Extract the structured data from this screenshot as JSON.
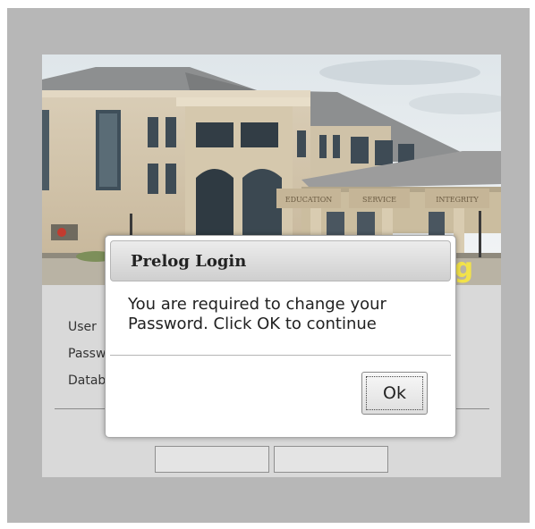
{
  "login_form": {
    "user_label": "User",
    "password_label": "Passw",
    "database_label": "Datab",
    "banner_partial_text": "og"
  },
  "building_sign": {
    "words": [
      "EDUCATION",
      "SERVICE",
      "INTEGRITY"
    ]
  },
  "dialog": {
    "title": "Prelog Login",
    "message": "You are required to change your Password. Click OK to continue",
    "ok_label": "Ok"
  }
}
